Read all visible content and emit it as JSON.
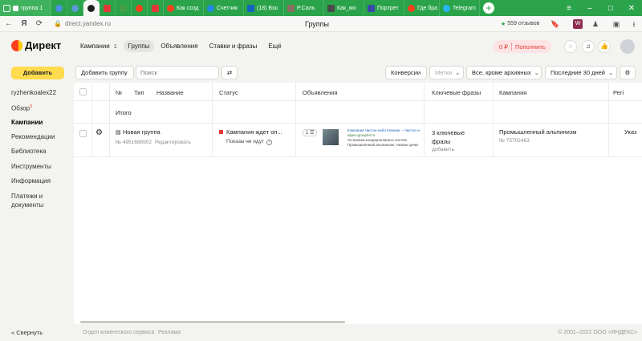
{
  "browser": {
    "tabs": [
      {
        "label": "группа 1",
        "color": "#cc3d2a"
      },
      {
        "label": "",
        "color": "#4a90e2"
      },
      {
        "label": "",
        "color": "#5b9bd5"
      },
      {
        "label": "",
        "color": "#1f1f1f"
      },
      {
        "label": "",
        "color": "#e53935"
      },
      {
        "label": "",
        "color": "#43a047"
      },
      {
        "label": "",
        "color": "#fc3f1d"
      },
      {
        "label": "",
        "color": "#e53935"
      },
      {
        "label": "Как созд",
        "color": "#fc3f1d"
      },
      {
        "label": "Счетчик",
        "color": "#1e88e5"
      },
      {
        "label": "(18) Вхо",
        "color": "#1565c0"
      },
      {
        "label": "P.Саль",
        "color": "#8d6e63"
      },
      {
        "label": "Как_мо",
        "color": "#4a4a4a"
      },
      {
        "label": "Портрет",
        "color": "#3949ab"
      },
      {
        "label": "Где бра",
        "color": "#fc3f1d"
      },
      {
        "label": "Telegram",
        "color": "#29b6f6"
      }
    ],
    "url": "direct.yandex.ru",
    "page_title": "Группы",
    "reviews": "559 отзывов"
  },
  "header": {
    "logo": "Директ",
    "nav": [
      {
        "label": "Кампании",
        "count": "1"
      },
      {
        "label": "Группы"
      },
      {
        "label": "Объявления"
      },
      {
        "label": "Ставки и фразы"
      },
      {
        "label": "Ещё"
      }
    ],
    "balance": "0 ₽",
    "pay_label": "Пополнить"
  },
  "sidebar": {
    "add_label": "Добавить",
    "account": "ryzhenkoalex22",
    "items": [
      {
        "label": "Обзор",
        "badge": "9"
      },
      {
        "label": "Кампании"
      },
      {
        "label": "Рекомендации"
      },
      {
        "label": "Библиотека"
      },
      {
        "label": "Инструменты"
      },
      {
        "label": "Информация"
      },
      {
        "label": "Платежи и документы"
      }
    ]
  },
  "toolbar": {
    "add_group": "Добавить группу",
    "search_placeholder": "Поиск",
    "conversions": "Конверсии",
    "tags": "Метки",
    "archive_filter": "Все, кроме архивных",
    "period": "Последние 30 дней"
  },
  "table": {
    "columns": {
      "num": "№",
      "type": "Тип",
      "name": "Название",
      "status": "Статус",
      "ads": "Объявления",
      "phrases": "Ключевые фразы",
      "campaign": "Кампания",
      "region": "Регі"
    },
    "total_label": "Итого",
    "row": {
      "name": "Новая группа",
      "number": "№ 4951686502",
      "edit": "Редактировать",
      "status": "Кампания ждет оп...",
      "status_sub": "Показы не идут",
      "ads_count": "1",
      "ad_title": "Компания Чистое небо Клининг – Чистое не...",
      "ad_domain": "alpen-group04.ru",
      "ad_line1": "Установка кондиционерных систем.",
      "ad_line2": "Промышленный альпинизм. Низкие цены! Ст...",
      "phrases_line1": "3 ключевые",
      "phrases_line2": "фразы",
      "phrases_add": "добавить",
      "campaign": "Промышленный альпинизм",
      "campaign_num": "№ 75702463",
      "region": "Указ"
    }
  },
  "footer": {
    "collapse": "Свернуть",
    "links": [
      "Отдел клиентского сервиса",
      "Реклама"
    ],
    "copyright": "© 2001–2022 ООО «ЯНДЕКС»"
  }
}
